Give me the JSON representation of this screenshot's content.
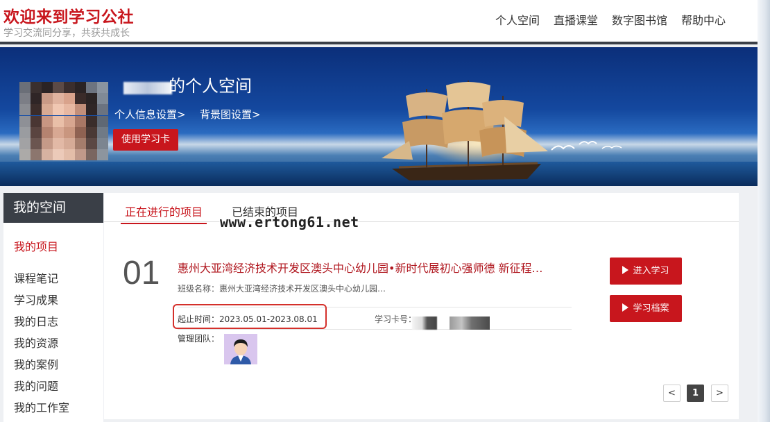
{
  "header": {
    "site_title": "欢迎来到学习公社",
    "site_subtitle": "学习交流同分享，共获共成长",
    "nav": [
      "个人空间",
      "直播课堂",
      "数字图书馆",
      "帮助中心"
    ]
  },
  "banner": {
    "space_title": "的个人空间",
    "profile_settings_link": "个人信息设置>",
    "background_settings_link": "背景图设置>",
    "use_card_button": "使用学习卡"
  },
  "sidebar": {
    "heading": "我的空间",
    "items": [
      "我的项目",
      "课程笔记",
      "学习成果",
      "我的日志",
      "我的资源",
      "我的案例",
      "我的问题",
      "我的工作室"
    ]
  },
  "main": {
    "tabs": [
      "正在进行的项目",
      "已结束的项目"
    ],
    "watermark": "www.ertong61.net",
    "project": {
      "number": "01",
      "title": "惠州大亚湾经济技术开发区澳头中心幼儿园•新时代展初心强师德 新征程…",
      "class_name": "班级名称：惠州大亚湾经济技术开发区澳头中心幼儿园…",
      "period": "起止时间：2023.05.01-2023.08.01",
      "card_number_label": "学习卡号：",
      "team_label": "管理团队："
    },
    "buttons": {
      "enter_study": "进入学习",
      "study_archive": "学习档案"
    },
    "pagination": {
      "prev": "<",
      "current": "1",
      "next": ">"
    }
  },
  "colors": {
    "brand_red": "#c8161d",
    "dark_bar": "#3a3f47"
  }
}
